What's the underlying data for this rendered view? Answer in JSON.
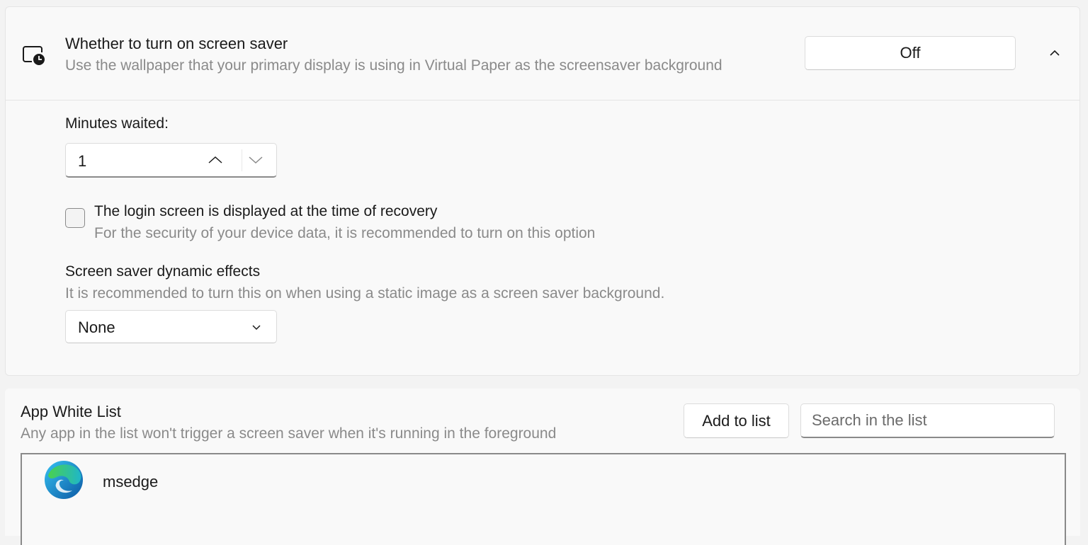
{
  "screensaver": {
    "title": "Whether to turn on screen saver",
    "description": "Use the wallpaper that your primary display is using in Virtual Paper as the screensaver background",
    "toggle_label": "Off",
    "icon": "screen-clock-icon",
    "expand_icon": "chevron-up-icon"
  },
  "minutes": {
    "label": "Minutes waited:",
    "value": "1",
    "up_icon": "chevron-up-icon",
    "down_icon": "chevron-down-icon"
  },
  "login_option": {
    "label": "The login screen is displayed at the time of recovery",
    "description": "For the security of your device data, it is recommended to turn on this option",
    "checked": false
  },
  "dynamic_effects": {
    "label": "Screen saver dynamic effects",
    "description": "It is recommended to turn this on when using a static image as a screen saver background.",
    "selected": "None"
  },
  "whitelist": {
    "title": "App White List",
    "description": "Any app in the list won't trigger a screen saver when it's running in the foreground",
    "add_label": "Add to list",
    "search_placeholder": "Search in the list",
    "items": [
      {
        "name": "msedge",
        "icon": "edge-browser-icon"
      }
    ]
  },
  "colors": {
    "background": "#f3f3f3",
    "card": "#f9f9f9",
    "secondary_text": "#8a8a8a"
  }
}
